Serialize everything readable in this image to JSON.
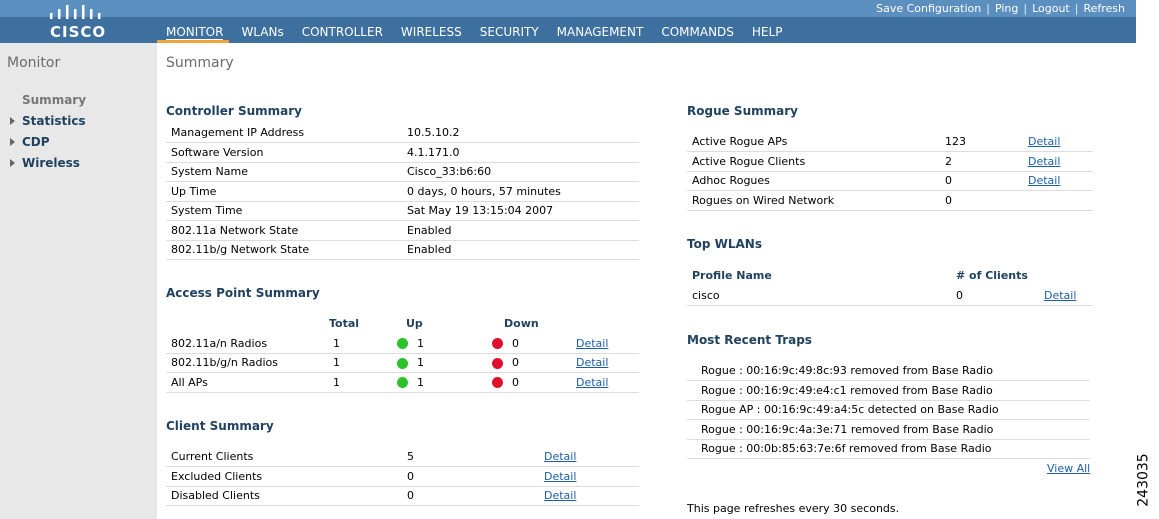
{
  "brand": {
    "name": "CISCO"
  },
  "utility_links": [
    "Save Configuration",
    "Ping",
    "Logout",
    "Refresh"
  ],
  "nav": [
    "MONITOR",
    "WLANs",
    "CONTROLLER",
    "WIRELESS",
    "SECURITY",
    "MANAGEMENT",
    "COMMANDS",
    "HELP"
  ],
  "colors": {
    "header": "#3d6f9f",
    "header_band": "#5b8fbf",
    "accent": "#f2a33a",
    "section_title": "#21425f",
    "link": "#1c5fa8",
    "status_up": "#2bc22b",
    "status_down": "#e0112e"
  },
  "sidebar": {
    "title": "Monitor",
    "items": [
      {
        "label": "Summary",
        "selected": true,
        "expandable": false
      },
      {
        "label": "Statistics",
        "selected": false,
        "expandable": true
      },
      {
        "label": "CDP",
        "selected": false,
        "expandable": true
      },
      {
        "label": "Wireless",
        "selected": false,
        "expandable": true
      }
    ]
  },
  "page_title": "Summary",
  "controller_summary": {
    "title": "Controller Summary",
    "rows": [
      {
        "label": "Management IP Address",
        "value": "10.5.10.2"
      },
      {
        "label": "Software Version",
        "value": "4.1.171.0"
      },
      {
        "label": "System Name",
        "value": "Cisco_33:b6:60"
      },
      {
        "label": "Up Time",
        "value": "0 days, 0 hours, 57 minutes"
      },
      {
        "label": "System Time",
        "value": "Sat May 19 13:15:04 2007"
      },
      {
        "label": "802.11a Network State",
        "value": "Enabled"
      },
      {
        "label": "802.11b/g Network State",
        "value": "Enabled"
      }
    ]
  },
  "access_point_summary": {
    "title": "Access Point Summary",
    "headers": {
      "total": "Total",
      "up": "Up",
      "down": "Down"
    },
    "rows": [
      {
        "label": "802.11a/n Radios",
        "total": "1",
        "up": "1",
        "down": "0",
        "link": "Detail"
      },
      {
        "label": "802.11b/g/n Radios",
        "total": "1",
        "up": "1",
        "down": "0",
        "link": "Detail"
      },
      {
        "label": "All APs",
        "total": "1",
        "up": "1",
        "down": "0",
        "link": "Detail"
      }
    ]
  },
  "client_summary": {
    "title": "Client Summary",
    "rows": [
      {
        "label": "Current Clients",
        "value": "5",
        "link": "Detail"
      },
      {
        "label": "Excluded Clients",
        "value": "0",
        "link": "Detail"
      },
      {
        "label": "Disabled Clients",
        "value": "0",
        "link": "Detail"
      }
    ]
  },
  "rogue_summary": {
    "title": "Rogue Summary",
    "rows": [
      {
        "label": "Active Rogue APs",
        "value": "123",
        "link": "Detail"
      },
      {
        "label": "Active Rogue Clients",
        "value": "2",
        "link": "Detail"
      },
      {
        "label": "Adhoc Rogues",
        "value": "0",
        "link": "Detail"
      },
      {
        "label": "Rogues on Wired Network",
        "value": "0",
        "link": ""
      }
    ]
  },
  "top_wlans": {
    "title": "Top WLANs",
    "headers": {
      "profile": "Profile Name",
      "clients": "# of Clients"
    },
    "rows": [
      {
        "profile": "cisco",
        "clients": "0",
        "link": "Detail"
      }
    ]
  },
  "recent_traps": {
    "title": "Most Recent Traps",
    "items": [
      "Rogue : 00:16:9c:49:8c:93  removed from Base Radio",
      "Rogue : 00:16:9c:49:e4:c1  removed from Base Radio",
      "Rogue AP : 00:16:9c:49:a4:5c detected on Base Radio",
      "Rogue : 00:16:9c:4a:3e:71  removed from Base Radio",
      "Rogue : 00:0b:85:63:7e:6f  removed from Base Radio"
    ],
    "view_all": "View All"
  },
  "refresh_note": "This page refreshes every 30 seconds.",
  "figure_number": "243035"
}
